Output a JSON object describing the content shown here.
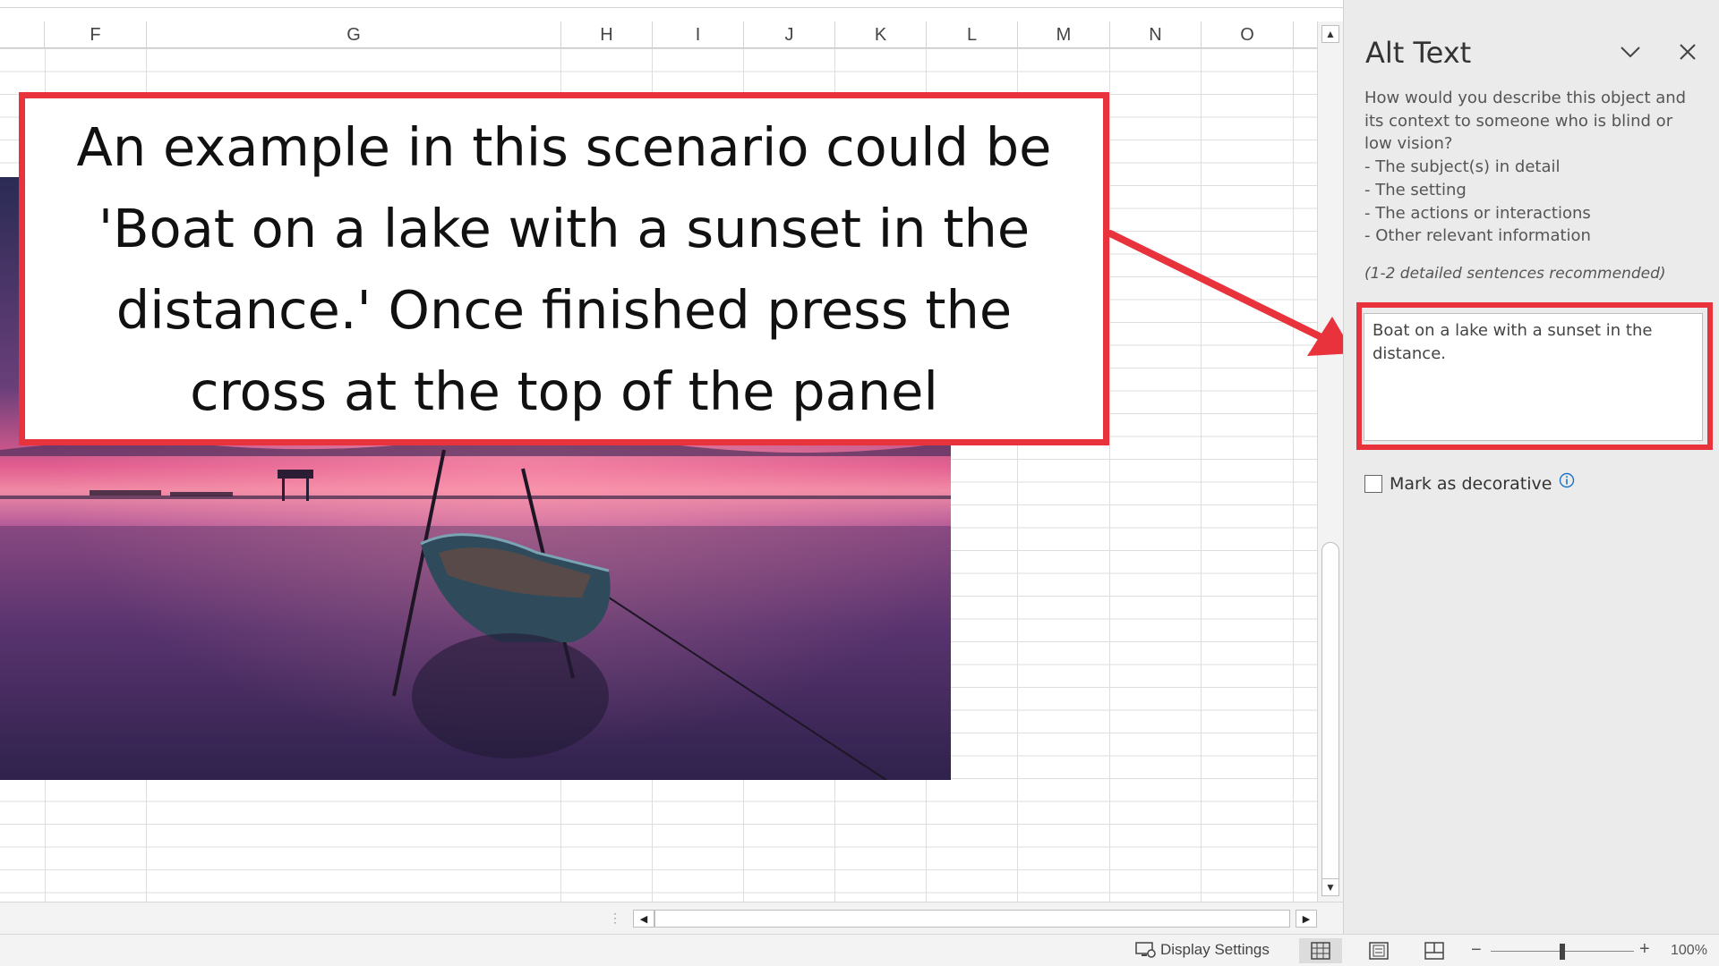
{
  "sheet": {
    "columns": [
      "F",
      "G",
      "H",
      "I",
      "J",
      "K",
      "L",
      "M",
      "N",
      "O"
    ]
  },
  "callout": {
    "text": "An example in this scenario could be 'Boat on a lake with a sunset in the distance.' Once finished press the cross at the top of the panel"
  },
  "alt_text_pane": {
    "title": "Alt Text",
    "description_lines": [
      "How would you describe this object and its context to someone who is blind or low vision?",
      "- The subject(s) in detail",
      "- The setting",
      "- The actions or interactions",
      "- Other relevant information"
    ],
    "hint": "(1-2 detailed sentences recommended)",
    "alt_text_value": "Boat on a lake with a sunset in the distance.",
    "mark_decorative_label": "Mark as decorative",
    "mark_decorative_checked": false,
    "collapse_icon": "chevron-down-icon",
    "close_icon": "close-icon",
    "info_icon": "info-icon"
  },
  "statusbar": {
    "display_settings_label": "Display Settings",
    "zoom_label": "100%",
    "zoom_percent": 100,
    "views": [
      "normal-view-icon",
      "page-layout-view-icon",
      "page-break-view-icon"
    ]
  },
  "colors": {
    "callout_border": "#e8323c",
    "info_blue": "#1a73c8"
  }
}
